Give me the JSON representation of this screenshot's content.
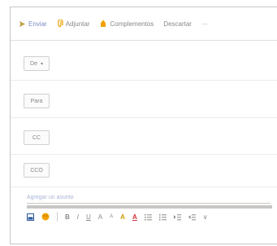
{
  "toolbar": {
    "send_label": "Enviar",
    "attach_label": "Adjuntar",
    "addins_label": "Complementos",
    "discard_label": "Descartar",
    "more_label": "···"
  },
  "fields": {
    "from_label": "De",
    "to_label": "Para",
    "cc_label": "CC",
    "bcc_label": "CCO"
  },
  "subject": {
    "placeholder": "Agregar un asunto"
  },
  "format_toolbar": {
    "bold": "B",
    "italic": "I",
    "underline": "U",
    "font_size": "A",
    "superscript": "A",
    "highlight": "A",
    "font_color": "A",
    "more": "∨"
  },
  "colors": {
    "accent": "#2b579a",
    "addins": "#f2a000",
    "font_color": "#d13438",
    "highlight": "#ffd800"
  }
}
